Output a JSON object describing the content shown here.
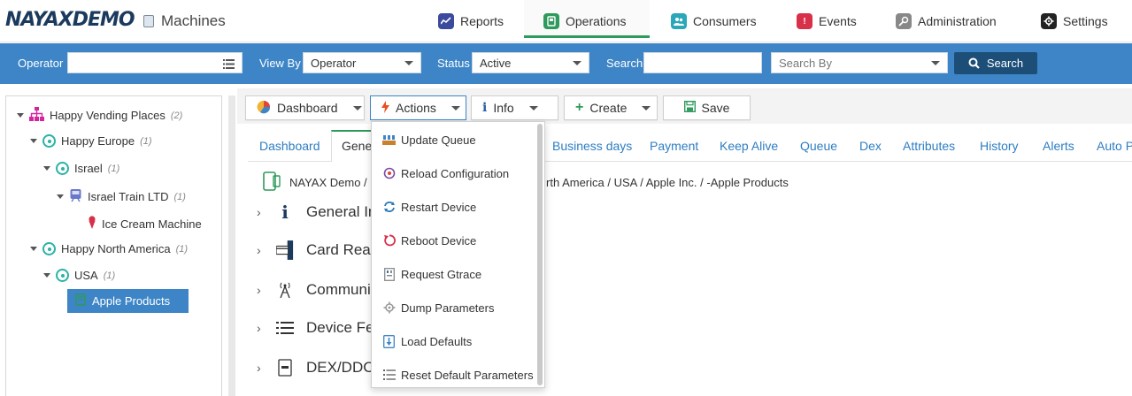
{
  "header": {
    "logo": "NAYAXDEMO",
    "page_title": "Machines",
    "nav": [
      {
        "label": "Reports",
        "icon": "reports-icon",
        "color": "#3b4a9c"
      },
      {
        "label": "Operations",
        "icon": "operations-icon",
        "color": "#2e9a5b"
      },
      {
        "label": "Consumers",
        "icon": "consumers-icon",
        "color": "#2aa7b8"
      },
      {
        "label": "Events",
        "icon": "events-icon",
        "color": "#d9304a"
      },
      {
        "label": "Administration",
        "icon": "administration-icon",
        "color": "#888888"
      },
      {
        "label": "Settings",
        "icon": "settings-icon",
        "color": "#222222"
      }
    ]
  },
  "search": {
    "operator_label": "Operator",
    "operator_value": "",
    "view_by_label": "View By",
    "view_by_value": "Operator",
    "status_label": "Status",
    "status_value": "Active",
    "search_label": "Search",
    "search_value": "",
    "search_by_placeholder": "Search By",
    "search_button": "Search"
  },
  "tree": {
    "nodes": [
      {
        "label": "Happy Vending Places",
        "count": "(2)"
      },
      {
        "label": "Happy Europe",
        "count": "(1)"
      },
      {
        "label": "Israel",
        "count": "(1)"
      },
      {
        "label": "Israel Train LTD",
        "count": "(1)"
      },
      {
        "label": "Ice Cream Machine",
        "count": ""
      },
      {
        "label": "Happy North America",
        "count": "(1)"
      },
      {
        "label": "USA",
        "count": "(1)"
      },
      {
        "label": "Apple Products",
        "count": ""
      }
    ]
  },
  "toolbar": {
    "dashboard": "Dashboard",
    "actions": "Actions",
    "info": "Info",
    "create": "Create",
    "save": "Save"
  },
  "tabs": [
    "Dashboard",
    "Gene",
    "Business days",
    "Payment",
    "Keep Alive",
    "Queue",
    "Dex",
    "Attributes",
    "History",
    "Alerts",
    "Auto P"
  ],
  "breadcrumb": {
    "left": "NAYAX Demo /",
    "right": "rth America / USA / Apple Inc. / -Apple Products"
  },
  "sections": [
    "General Inf",
    "Card Reade",
    "Communic",
    "Device Fea",
    "DEX/DDCM"
  ],
  "actions_menu": [
    {
      "label": "Update Queue",
      "icon": "update-queue-icon"
    },
    {
      "label": "Reload Configuration",
      "icon": "reload-configuration-icon"
    },
    {
      "label": "Restart Device",
      "icon": "restart-device-icon"
    },
    {
      "label": "Reboot Device",
      "icon": "reboot-device-icon"
    },
    {
      "label": "Request Gtrace",
      "icon": "request-gtrace-icon"
    },
    {
      "label": "Dump Parameters",
      "icon": "dump-parameters-icon"
    },
    {
      "label": "Load Defaults",
      "icon": "load-defaults-icon"
    },
    {
      "label": "Reset Default Parameters",
      "icon": "reset-default-parameters-icon"
    }
  ]
}
